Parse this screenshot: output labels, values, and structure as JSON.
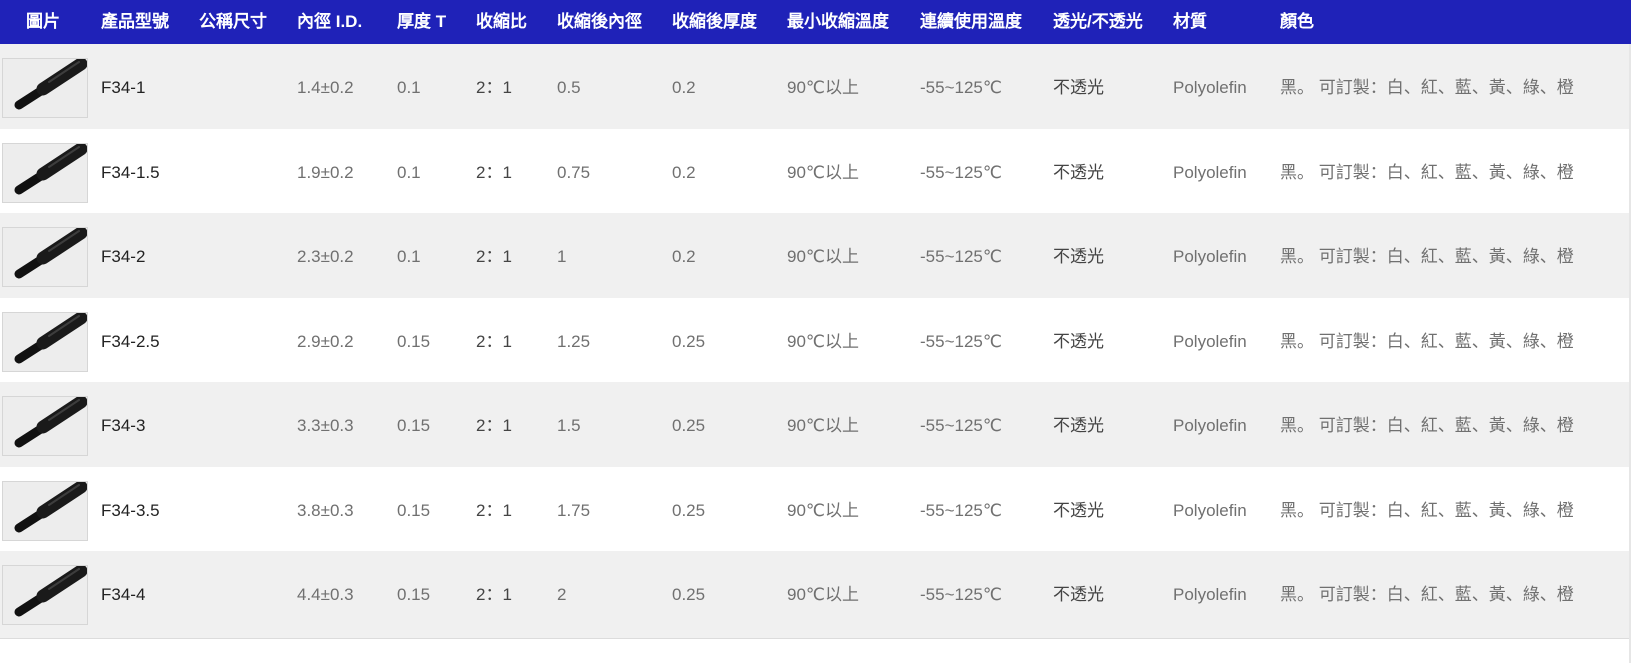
{
  "table": {
    "headers": [
      "圖片",
      "產品型號",
      "公稱尺寸",
      "內徑 I.D.",
      "厚度 T",
      "收縮比",
      "收縮後內徑",
      "收縮後厚度",
      "最小收縮溫度",
      "連續使用溫度",
      "透光/不透光",
      "材質",
      "顏色"
    ],
    "thumbnail_icon": "heat-shrink-tube-icon",
    "rows": [
      {
        "model": "F34-1",
        "nominal": "",
        "id": "1.4±0.2",
        "thickness": "0.1",
        "ratio": "2：1",
        "shrunk_id": "0.5",
        "shrunk_thickness": "0.2",
        "min_temp": "90℃以上",
        "cont_temp": "-55~125℃",
        "opacity": "不透光",
        "material": "Polyolefin",
        "color": "黑。 可訂製：白、紅、藍、黃、綠、橙"
      },
      {
        "model": "F34-1.5",
        "nominal": "",
        "id": "1.9±0.2",
        "thickness": "0.1",
        "ratio": "2：1",
        "shrunk_id": "0.75",
        "shrunk_thickness": "0.2",
        "min_temp": "90℃以上",
        "cont_temp": "-55~125℃",
        "opacity": "不透光",
        "material": "Polyolefin",
        "color": "黑。 可訂製：白、紅、藍、黃、綠、橙"
      },
      {
        "model": "F34-2",
        "nominal": "",
        "id": "2.3±0.2",
        "thickness": "0.1",
        "ratio": "2：1",
        "shrunk_id": "1",
        "shrunk_thickness": "0.2",
        "min_temp": "90℃以上",
        "cont_temp": "-55~125℃",
        "opacity": "不透光",
        "material": "Polyolefin",
        "color": "黑。 可訂製：白、紅、藍、黃、綠、橙"
      },
      {
        "model": "F34-2.5",
        "nominal": "",
        "id": "2.9±0.2",
        "thickness": "0.15",
        "ratio": "2：1",
        "shrunk_id": "1.25",
        "shrunk_thickness": "0.25",
        "min_temp": "90℃以上",
        "cont_temp": "-55~125℃",
        "opacity": "不透光",
        "material": "Polyolefin",
        "color": "黑。 可訂製：白、紅、藍、黃、綠、橙"
      },
      {
        "model": "F34-3",
        "nominal": "",
        "id": "3.3±0.3",
        "thickness": "0.15",
        "ratio": "2：1",
        "shrunk_id": "1.5",
        "shrunk_thickness": "0.25",
        "min_temp": "90℃以上",
        "cont_temp": "-55~125℃",
        "opacity": "不透光",
        "material": "Polyolefin",
        "color": "黑。 可訂製：白、紅、藍、黃、綠、橙"
      },
      {
        "model": "F34-3.5",
        "nominal": "",
        "id": "3.8±0.3",
        "thickness": "0.15",
        "ratio": "2：1",
        "shrunk_id": "1.75",
        "shrunk_thickness": "0.25",
        "min_temp": "90℃以上",
        "cont_temp": "-55~125℃",
        "opacity": "不透光",
        "material": "Polyolefin",
        "color": "黑。 可訂製：白、紅、藍、黃、綠、橙"
      },
      {
        "model": "F34-4",
        "nominal": "",
        "id": "4.4±0.3",
        "thickness": "0.15",
        "ratio": "2：1",
        "shrunk_id": "2",
        "shrunk_thickness": "0.25",
        "min_temp": "90℃以上",
        "cont_temp": "-55~125℃",
        "opacity": "不透光",
        "material": "Polyolefin",
        "color": "黑。 可訂製：白、紅、藍、黃、綠、橙"
      }
    ]
  },
  "colors": {
    "header_bg": "#1f22b8",
    "header_text": "#ffffff",
    "row_odd": "#f0f0f0",
    "row_even": "#ffffff",
    "text_primary": "#222222",
    "text_secondary": "#707070"
  }
}
